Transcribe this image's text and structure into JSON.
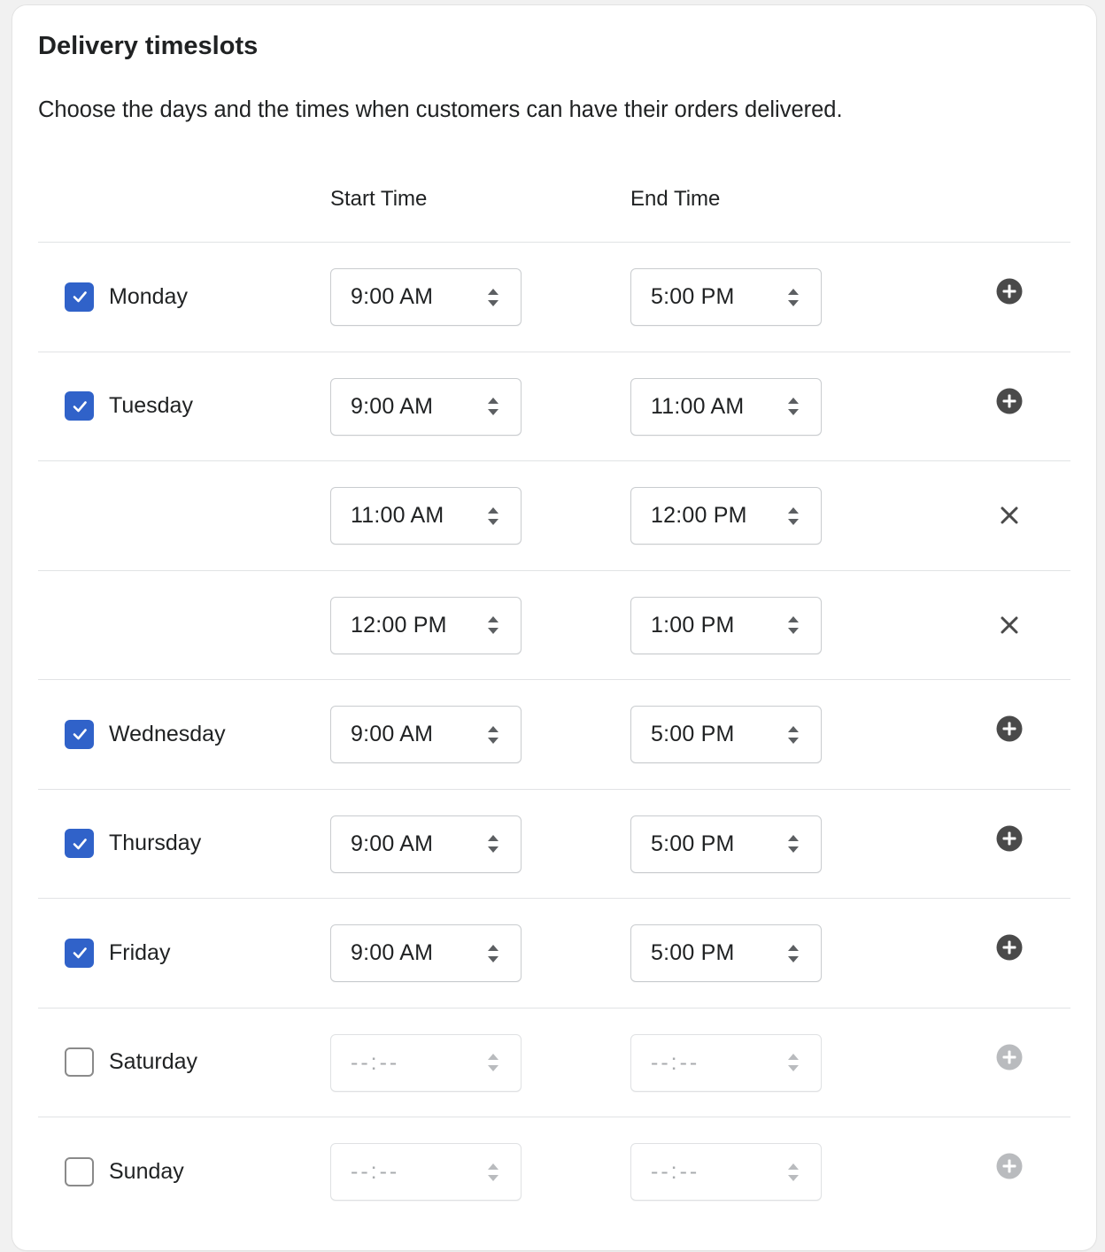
{
  "header": {
    "title": "Delivery timeslots",
    "description": "Choose the days and the times when customers can have their orders delivered."
  },
  "columns": {
    "start": "Start Time",
    "end": "End Time"
  },
  "colors": {
    "accent": "#3062c9",
    "icon": "#4a4a4a",
    "icon_disabled": "#b9bbbe"
  },
  "rows": [
    {
      "day": "Monday",
      "checked": true,
      "start": "9:00 AM",
      "end": "5:00 PM",
      "action": "add-icon",
      "enabled": true
    },
    {
      "day": "Tuesday",
      "checked": true,
      "start": "9:00 AM",
      "end": "11:00 AM",
      "action": "add-icon",
      "enabled": true
    },
    {
      "day": "",
      "checked": null,
      "start": "11:00 AM",
      "end": "12:00 PM",
      "action": "close-icon",
      "enabled": true
    },
    {
      "day": "",
      "checked": null,
      "start": "12:00 PM",
      "end": "1:00 PM",
      "action": "close-icon",
      "enabled": true
    },
    {
      "day": "Wednesday",
      "checked": true,
      "start": "9:00 AM",
      "end": "5:00 PM",
      "action": "add-icon",
      "enabled": true
    },
    {
      "day": "Thursday",
      "checked": true,
      "start": "9:00 AM",
      "end": "5:00 PM",
      "action": "add-icon",
      "enabled": true
    },
    {
      "day": "Friday",
      "checked": true,
      "start": "9:00 AM",
      "end": "5:00 PM",
      "action": "add-icon",
      "enabled": true
    },
    {
      "day": "Saturday",
      "checked": false,
      "start": "--:--",
      "end": "--:--",
      "action": "add-icon",
      "enabled": false
    },
    {
      "day": "Sunday",
      "checked": false,
      "start": "--:--",
      "end": "--:--",
      "action": "add-icon",
      "enabled": false
    }
  ]
}
